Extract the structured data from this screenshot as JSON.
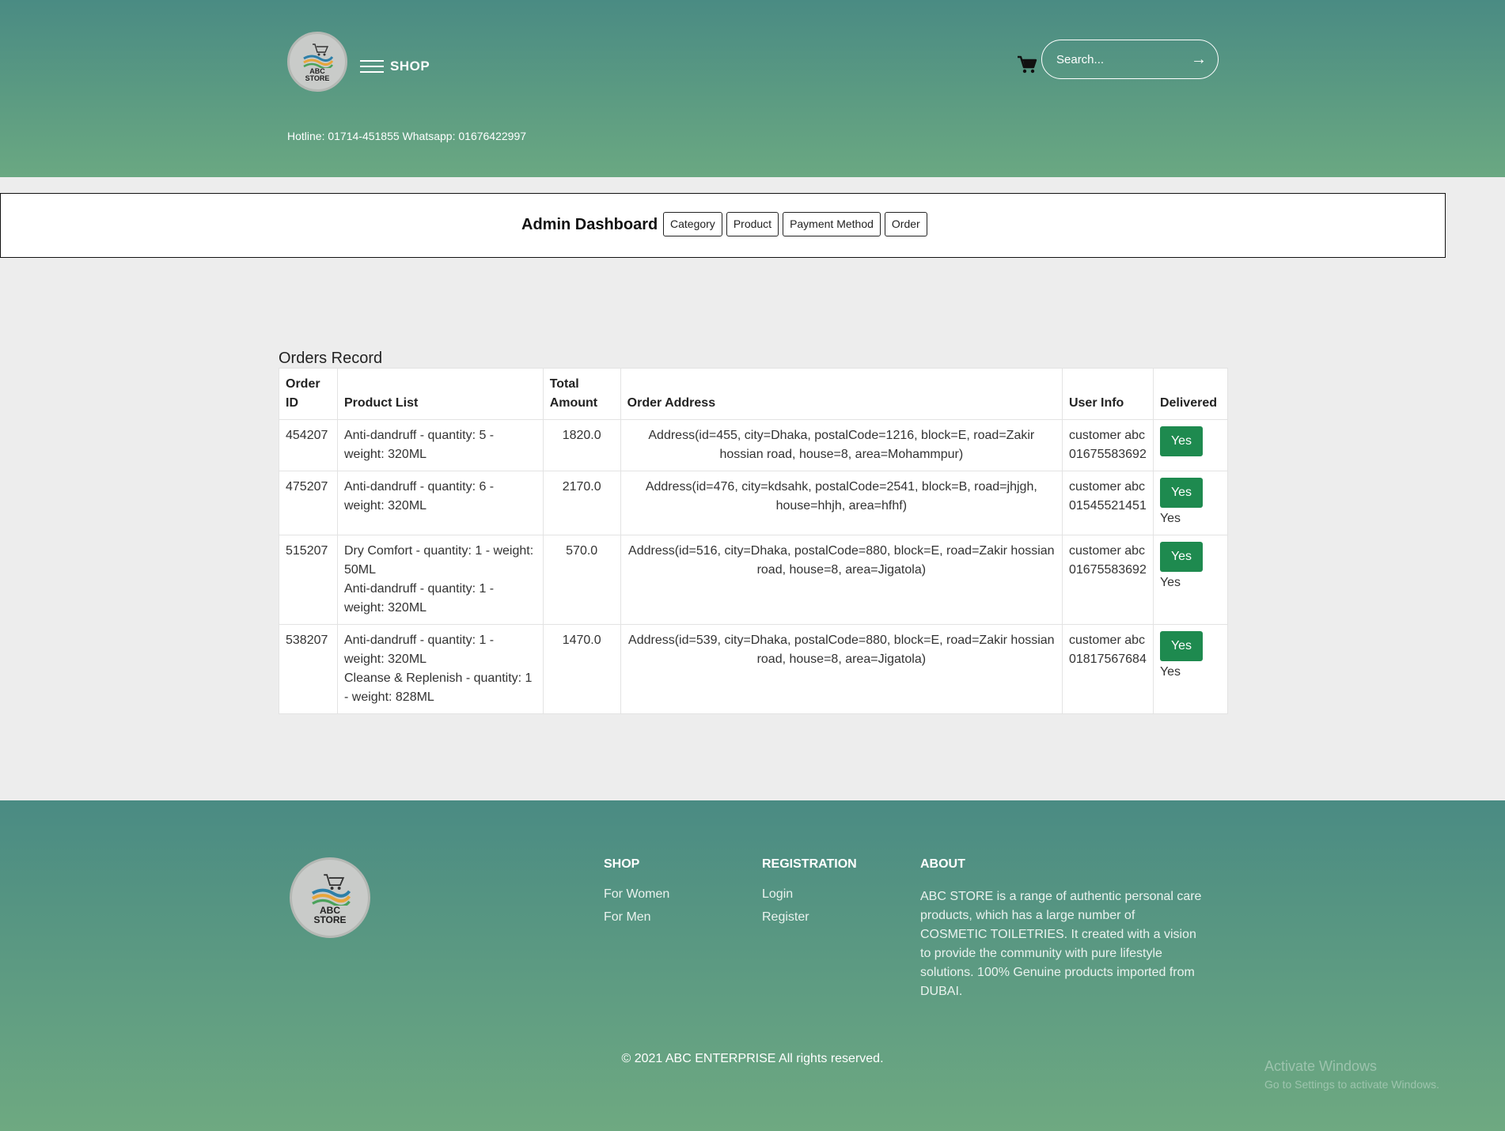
{
  "header": {
    "logo_line1": "ABC",
    "logo_line2": "STORE",
    "menu_label": "SHOP",
    "hotline": "Hotline: 01714-451855 Whatsapp: 01676422997",
    "search_placeholder": "Search...",
    "search_submit": "→"
  },
  "admin": {
    "title": "Admin Dashboard",
    "buttons": [
      "Category",
      "Product",
      "Payment Method",
      "Order"
    ]
  },
  "orders": {
    "title": "Orders Record",
    "columns": [
      "Order ID",
      "Product List",
      "Total Amount",
      "Order Address",
      "User Info",
      "Delivered"
    ],
    "rows": [
      {
        "id": "454207",
        "products": [
          "Anti-dandruff - quantity: 5 - weight: 320ML"
        ],
        "amount": "1820.0",
        "address": "Address(id=455, city=Dhaka, postalCode=1216, block=E, road=Zakir hossian road, house=8, area=Mohammpur)",
        "user_name": "customer abc",
        "user_phone": "01675583692",
        "delivered_button": "Yes",
        "delivered_text": ""
      },
      {
        "id": "475207",
        "products": [
          "Anti-dandruff - quantity: 6 - weight: 320ML"
        ],
        "amount": "2170.0",
        "address": "Address(id=476, city=kdsahk, postalCode=2541, block=B, road=jhjgh, house=hhjh, area=hfhf)",
        "user_name": "customer abc",
        "user_phone": "01545521451",
        "delivered_button": "Yes",
        "delivered_text": "Yes"
      },
      {
        "id": "515207",
        "products": [
          "Dry Comfort - quantity: 1 - weight: 50ML",
          "Anti-dandruff - quantity: 1 - weight: 320ML"
        ],
        "amount": "570.0",
        "address": "Address(id=516, city=Dhaka, postalCode=880, block=E, road=Zakir hossian road, house=8, area=Jigatola)",
        "user_name": "customer abc",
        "user_phone": "01675583692",
        "delivered_button": "Yes",
        "delivered_text": "Yes"
      },
      {
        "id": "538207",
        "products": [
          "Anti-dandruff - quantity: 1 - weight: 320ML",
          "Cleanse & Replenish - quantity: 1 - weight: 828ML"
        ],
        "amount": "1470.0",
        "address": "Address(id=539, city=Dhaka, postalCode=880, block=E, road=Zakir hossian road, house=8, area=Jigatola)",
        "user_name": "customer abc",
        "user_phone": "01817567684",
        "delivered_button": "Yes",
        "delivered_text": "Yes"
      }
    ]
  },
  "footer": {
    "shop": {
      "heading": "SHOP",
      "links": [
        "For Women",
        "For Men"
      ]
    },
    "registration": {
      "heading": "REGISTRATION",
      "links": [
        "Login",
        "Register"
      ]
    },
    "about": {
      "heading": "ABOUT",
      "text": "ABC STORE is a range of authentic personal care products, which has a large number of COSMETIC TOILETRIES. It created with a vision to provide the community with pure lifestyle solutions. 100% Genuine products imported from DUBAI."
    },
    "copyright": "© 2021 ABC ENTERPRISE All rights reserved.",
    "watermark_title": "Activate Windows",
    "watermark_sub": "Go to Settings to activate Windows."
  },
  "colors": {
    "header_top": "#4a8b83",
    "header_bottom": "#6aa882",
    "delivered_button": "#1e8a4f"
  },
  "icons": [
    "cart-icon",
    "menu-icon",
    "arrow-right-icon",
    "store-logo"
  ]
}
